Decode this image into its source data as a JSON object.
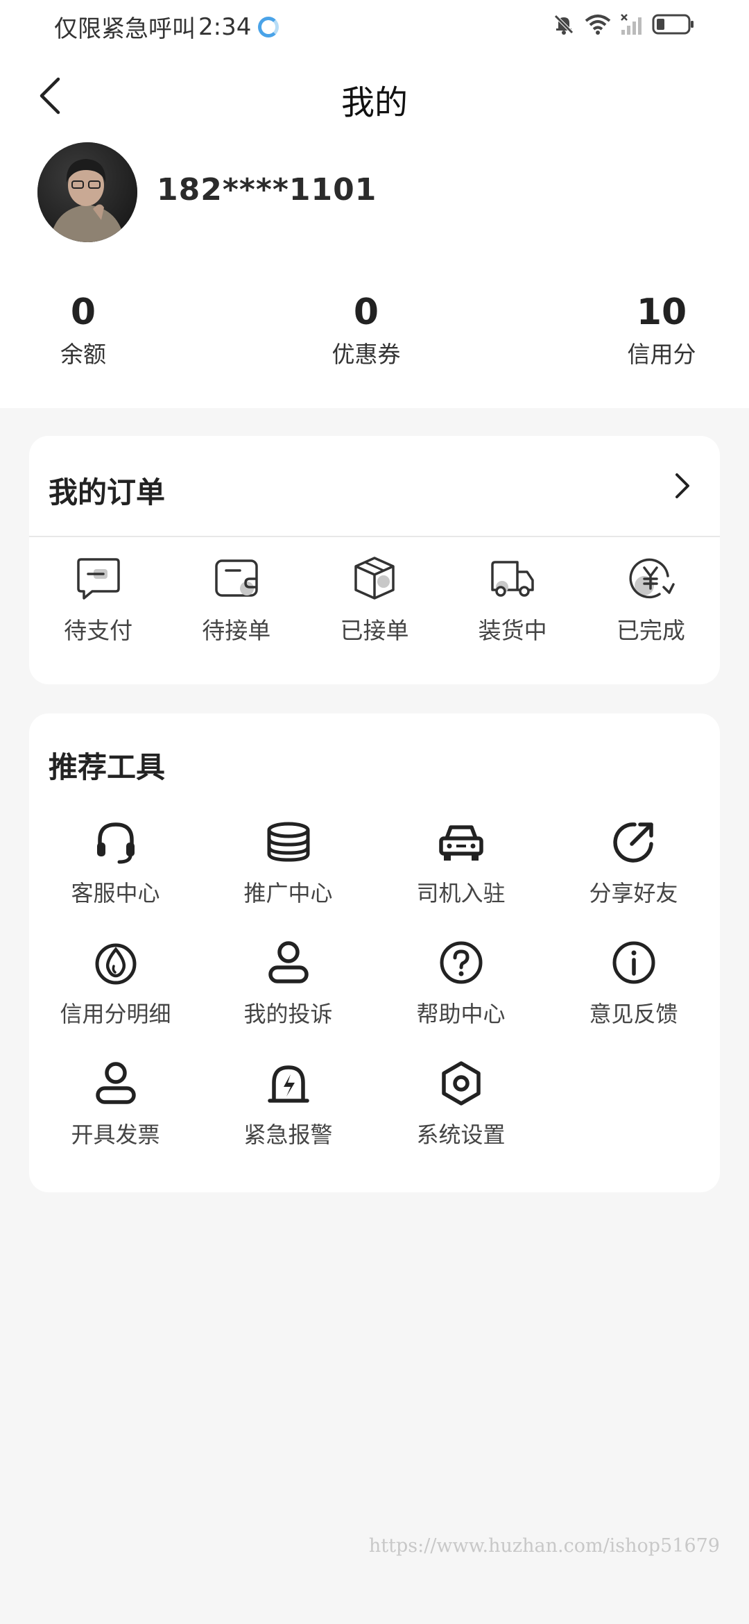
{
  "status_bar": {
    "carrier": "仅限紧急呼叫",
    "time": "2:34",
    "icons": [
      "app-icon",
      "mute-bell-icon",
      "wifi-icon",
      "no-signal-icon",
      "battery-icon"
    ]
  },
  "header": {
    "title": "我的",
    "back_icon": "back-arrow-icon"
  },
  "profile": {
    "phone": "182****1101"
  },
  "stats": [
    {
      "value": "0",
      "label": "余额"
    },
    {
      "value": "0",
      "label": "优惠券"
    },
    {
      "value": "10",
      "label": "信用分"
    }
  ],
  "orders": {
    "title": "我的订单",
    "chevron_icon": "chevron-right-icon",
    "items": [
      {
        "label": "待支付",
        "icon": "pending-payment-icon"
      },
      {
        "label": "待接单",
        "icon": "wallet-icon"
      },
      {
        "label": "已接单",
        "icon": "package-icon"
      },
      {
        "label": "装货中",
        "icon": "truck-icon"
      },
      {
        "label": "已完成",
        "icon": "yuan-completed-icon"
      }
    ]
  },
  "tools": {
    "title": "推荐工具",
    "items": [
      {
        "label": "客服中心",
        "icon": "headset-icon"
      },
      {
        "label": "推广中心",
        "icon": "coins-stack-icon"
      },
      {
        "label": "司机入驻",
        "icon": "car-icon"
      },
      {
        "label": "分享好友",
        "icon": "share-icon"
      },
      {
        "label": "信用分明细",
        "icon": "drop-icon"
      },
      {
        "label": "我的投诉",
        "icon": "user-icon"
      },
      {
        "label": "帮助中心",
        "icon": "question-icon"
      },
      {
        "label": "意见反馈",
        "icon": "info-icon"
      },
      {
        "label": "开具发票",
        "icon": "invoice-user-icon"
      },
      {
        "label": "紧急报警",
        "icon": "alarm-icon"
      },
      {
        "label": "系统设置",
        "icon": "settings-hex-icon"
      }
    ]
  },
  "watermark": "https://www.huzhan.com/ishop51679",
  "colors": {
    "background": "#f6f6f6",
    "card": "#ffffff",
    "text": "#222222",
    "icon_accent": "#c8c8c8"
  }
}
